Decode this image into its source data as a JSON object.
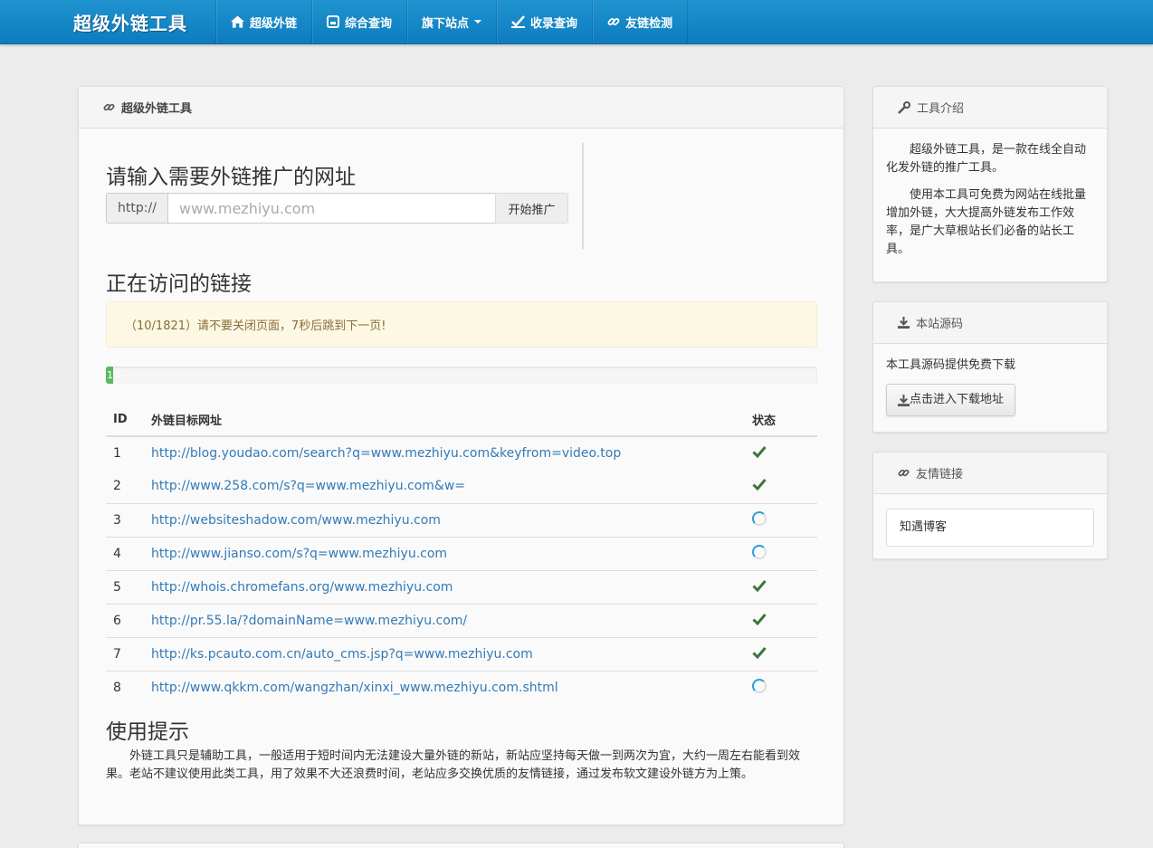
{
  "navbar": {
    "brand": "超级外链工具",
    "items": [
      {
        "label": "超级外链",
        "icon": "home-icon"
      },
      {
        "label": "综合查询",
        "icon": "hdd-icon"
      },
      {
        "label": "旗下站点",
        "icon": "",
        "dropdown": true
      },
      {
        "label": "收录查询",
        "icon": "check-icon"
      },
      {
        "label": "友链检测",
        "icon": "link-icon"
      }
    ],
    "bg_color": "#1a8bc9"
  },
  "main": {
    "panel_title": "超级外链工具",
    "input_heading": "请输入需要外链推广的网址",
    "url_prefix": "http://",
    "url_placeholder": "www.mezhiyu.com",
    "start_button": "开始推广",
    "visit_heading": "正在访问的链接",
    "alert_text": "（10/1821）请不要关闭页面，7秒后跳到下一页!",
    "progress": {
      "percent": 1,
      "label": "1%",
      "color": "#5cb85c"
    },
    "table": {
      "headers": {
        "id": "ID",
        "url": "外链目标网址",
        "status": "状态"
      },
      "rows": [
        {
          "id": "1",
          "url": "http://blog.youdao.com/search?q=www.mezhiyu.com&keyfrom=video.top",
          "status": "done"
        },
        {
          "id": "2",
          "url": "http://www.258.com/s?q=www.mezhiyu.com&w=",
          "status": "done"
        },
        {
          "id": "3",
          "url": "http://websiteshadow.com/www.mezhiyu.com",
          "status": "loading"
        },
        {
          "id": "4",
          "url": "http://www.jianso.com/s?q=www.mezhiyu.com",
          "status": "loading"
        },
        {
          "id": "5",
          "url": "http://whois.chromefans.org/www.mezhiyu.com",
          "status": "done"
        },
        {
          "id": "6",
          "url": "http://pr.55.la/?domainName=www.mezhiyu.com/",
          "status": "done"
        },
        {
          "id": "7",
          "url": "http://ks.pcauto.com.cn/auto_cms.jsp?q=www.mezhiyu.com",
          "status": "done"
        },
        {
          "id": "8",
          "url": "http://www.qkkm.com/wangzhan/xinxi_www.mezhiyu.com.shtml",
          "status": "loading"
        }
      ]
    },
    "tips_heading": "使用提示",
    "tips_text": "外链工具只是辅助工具，一般适用于短时间内无法建设大量外链的新站，新站应坚持每天做一到两次为宜，大约一周左右能看到效果。老站不建议使用此类工具，用了效果不大还浪费时间，老站应多交换优质的友情链接，通过发布软文建设外链方为上策。"
  },
  "sidebar": {
    "intro": {
      "title": "工具介绍",
      "p1": "超级外链工具，是一款在线全自动化发外链的推广工具。",
      "p2": "使用本工具可免费为网站在线批量增加外链，大大提高外链发布工作效率，是广大草根站长们必备的站长工具。"
    },
    "source": {
      "title": "本站源码",
      "text": "本工具源码提供免费下载",
      "button": "点击进入下载地址"
    },
    "friends": {
      "title": "友情链接",
      "links": [
        "知遇博客"
      ]
    }
  }
}
